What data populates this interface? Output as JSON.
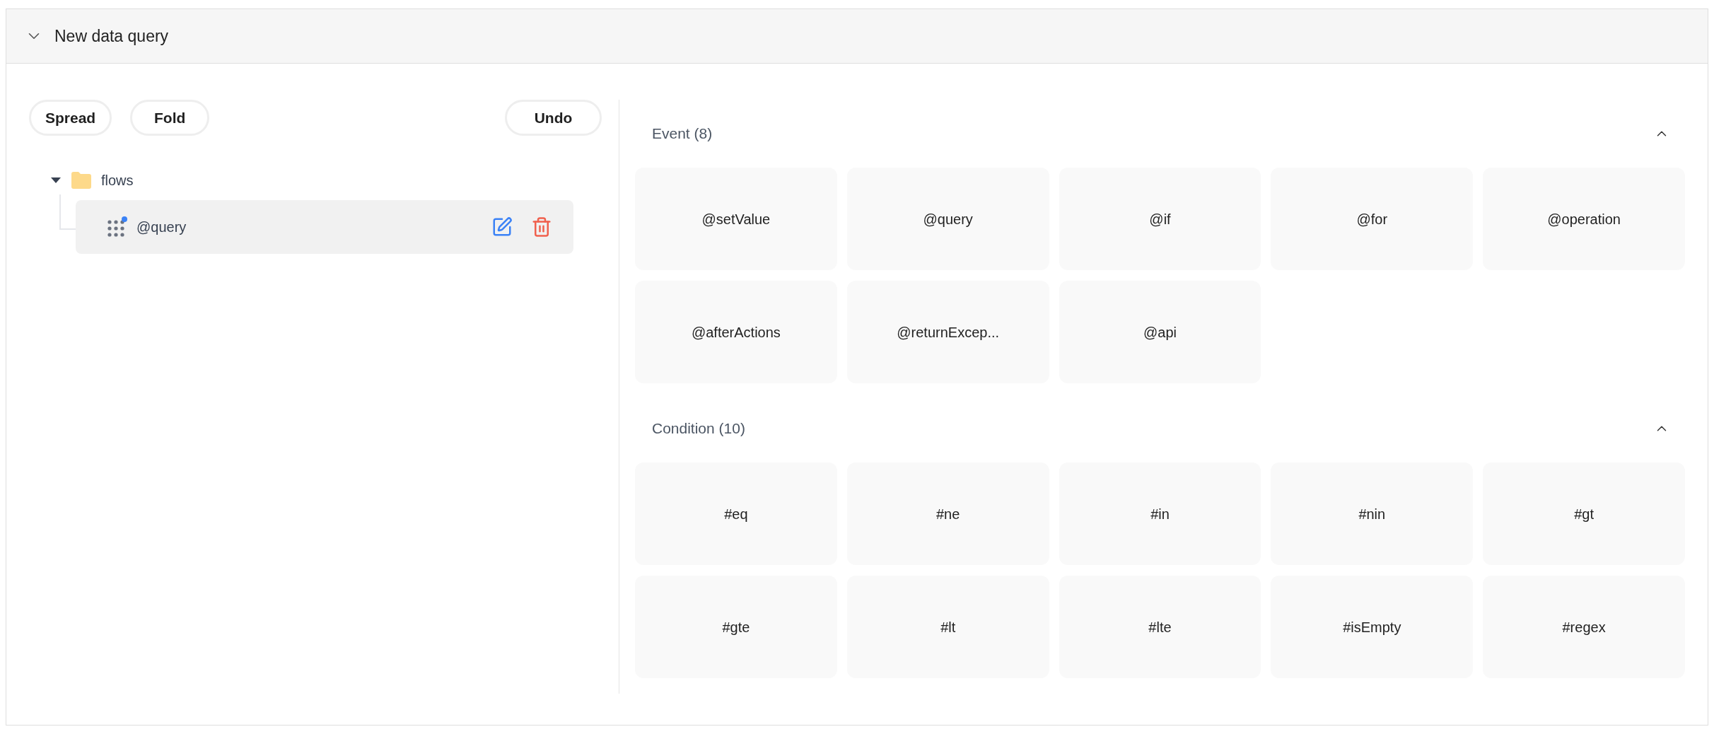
{
  "panel": {
    "title": "New data query",
    "expanded": true
  },
  "toolbar": {
    "buttons": [
      "Spread",
      "Fold"
    ],
    "undo": "Undo"
  },
  "tree": [
    {
      "label": "flows",
      "kind": "folder",
      "expanded": true,
      "selected": false,
      "children": [
        {
          "label": "@query",
          "kind": "node",
          "selected": true
        }
      ]
    }
  ],
  "sections": [
    {
      "title": "Event (8)",
      "expanded": true,
      "items": [
        "@setValue",
        "@query",
        "@if",
        "@for",
        "@operation",
        "@afterActions",
        "@returnExcep...",
        "@api"
      ]
    },
    {
      "title": "Condition (10)",
      "expanded": true,
      "items": [
        "#eq",
        "#ne",
        "#in",
        "#nin",
        "#gt",
        "#gte",
        "#lt",
        "#lte",
        "#isEmpty",
        "#regex"
      ]
    }
  ]
}
